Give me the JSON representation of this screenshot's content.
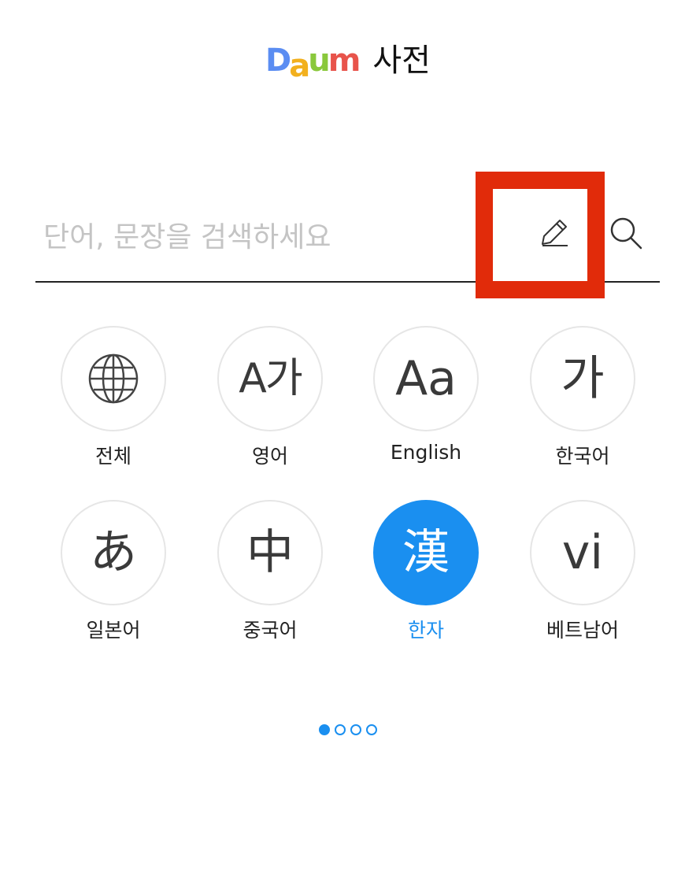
{
  "header": {
    "logo": [
      "D",
      "a",
      "u",
      "m"
    ],
    "title": "사전"
  },
  "search": {
    "placeholder": "단어, 문장을 검색하세요",
    "value": ""
  },
  "icons": {
    "handwrite": "pencil-icon",
    "search": "search-icon",
    "all": "globe-icon"
  },
  "dictionaries": [
    {
      "id": "all",
      "glyph": "",
      "label": "전체"
    },
    {
      "id": "english-korean",
      "glyph": "A가",
      "label": "영어"
    },
    {
      "id": "english",
      "glyph": "Aa",
      "label": "English"
    },
    {
      "id": "korean",
      "glyph": "가",
      "label": "한국어"
    },
    {
      "id": "japanese",
      "glyph": "あ",
      "label": "일본어"
    },
    {
      "id": "chinese",
      "glyph": "中",
      "label": "중국어"
    },
    {
      "id": "hanja",
      "glyph": "漢",
      "label": "한자",
      "selected": true
    },
    {
      "id": "vietnamese",
      "glyph": "vi",
      "label": "베트남어"
    }
  ],
  "pagination": {
    "pages": 4,
    "current": 1
  },
  "colors": {
    "accent": "#1a8ff0",
    "highlight": "#e12b0a",
    "placeholder": "#c4c4c4"
  }
}
